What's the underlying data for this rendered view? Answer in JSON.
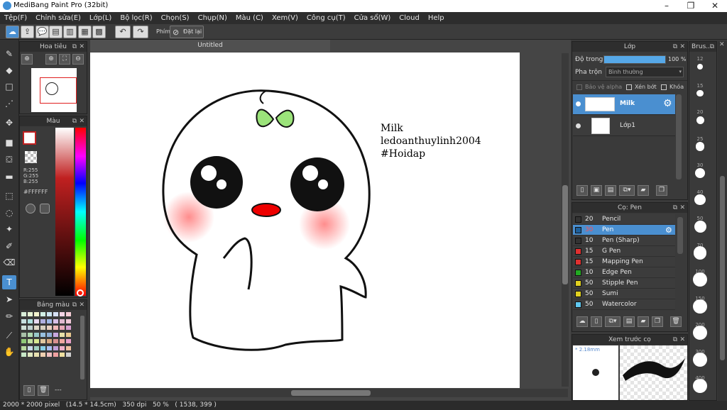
{
  "window": {
    "title": "MediBang Paint Pro (32bit)",
    "controls": [
      "–",
      "❐",
      "✕"
    ]
  },
  "menu": [
    "Tệp(F)",
    "Chỉnh sửa(E)",
    "Lớp(L)",
    "Bộ lọc(R)",
    "Chọn(S)",
    "Chụp(N)",
    "Màu (C)",
    "Xem(V)",
    "Công cụ(T)",
    "Cửa sổ(W)",
    "Cloud",
    "Help"
  ],
  "toolbar": {
    "shortcut_label": "Phím",
    "reset_label": "Đặt lại"
  },
  "navigator": {
    "title": "Hoa tiêu"
  },
  "color_panel": {
    "title": "Màu",
    "r": "R:255",
    "g": "G:255",
    "b": "B:255",
    "hex": "#FFFFFF"
  },
  "palette": {
    "title": "Bảng màu",
    "footer": "---",
    "colors": [
      "#d9eed9",
      "#e6f3d3",
      "#f2f2cc",
      "#d1f0e6",
      "#cce6f2",
      "#d5e0f5",
      "#f5d5e6",
      "#f5ccd6",
      "#c8e0e0",
      "#b0e0e0",
      "#e8d8f0",
      "#b0b0e0",
      "#a0b8e8",
      "#d8c0e8",
      "#e0b8d0",
      "#f0c8d8",
      "#d0e0d8",
      "#c0d0d0",
      "#e0d8c8",
      "#d8d0c0",
      "#e8d0c0",
      "#f0b8b8",
      "#e8a8b8",
      "#d8a0d0",
      "#a8c0a8",
      "#b0d8b0",
      "#98c8c8",
      "#98c0e0",
      "#90b0d8",
      "#c8a8e0",
      "#e8e0a8",
      "#e8c890",
      "#90c878",
      "#c0e0a0",
      "#d8e890",
      "#e0c8a0",
      "#d8a880",
      "#d89090",
      "#f0a8a0",
      "#e8a0c8",
      "#b8d8a0",
      "#c8d8e8",
      "#a0d0c0",
      "#88d0e8",
      "#a8c0f0",
      "#c0a0d8",
      "#f0b0c8",
      "#f0c0a0",
      "#c8e8c8",
      "#e0e8c0",
      "#e8e0b0",
      "#f0d0b0",
      "#f0c0c0",
      "#f0a0a0",
      "#f0e0a0",
      "#d0d0d0"
    ]
  },
  "document": {
    "tab": "Untitled"
  },
  "canvas_text": {
    "line1": "Milk",
    "line2": "ledoanthuylinh2004",
    "line3": "#Hoidap"
  },
  "layer_panel": {
    "title": "Lớp",
    "opacity_label": "Độ trong",
    "opacity_value": "100 %",
    "opacity": 1.0,
    "blend_label": "Pha trộn",
    "blend_value": "Bình thường",
    "protect_alpha": "Bảo vệ alpha",
    "clipping": "Xén bớt",
    "lock": "Khóa",
    "layers": [
      {
        "name": "Milk",
        "selected": true
      },
      {
        "name": "Lớp1",
        "selected": false
      }
    ]
  },
  "brush_panel": {
    "title": "Cọ: Pen",
    "brushes": [
      {
        "size": "20",
        "name": "Pencil",
        "color": "#333333"
      },
      {
        "size": "30",
        "name": "Pen",
        "color": "#1e5f9a",
        "selected": true
      },
      {
        "size": "10",
        "name": "Pen (Sharp)",
        "color": "#333333"
      },
      {
        "size": "15",
        "name": "G Pen",
        "color": "#e03030"
      },
      {
        "size": "15",
        "name": "Mapping Pen",
        "color": "#e03030"
      },
      {
        "size": "10",
        "name": "Edge Pen",
        "color": "#22aa22"
      },
      {
        "size": "50",
        "name": "Stipple Pen",
        "color": "#e0d020"
      },
      {
        "size": "50",
        "name": "Sumi",
        "color": "#e0d020"
      },
      {
        "size": "50",
        "name": "Watercolor",
        "color": "#60c8f0"
      }
    ]
  },
  "brush_preview": {
    "title": "Xem trước cọ",
    "size": "* 2.18mm"
  },
  "brush_size_panel": {
    "title": "Brus...",
    "sizes": [
      "12",
      "15",
      "20",
      "25",
      "30",
      "40",
      "50",
      "70",
      "100",
      "150",
      "200",
      "300",
      "400"
    ]
  },
  "status": {
    "text": "2000 * 2000 pixel   (14.5 * 14.5cm)   350 dpi   50 %   ( 1538, 399 )"
  }
}
